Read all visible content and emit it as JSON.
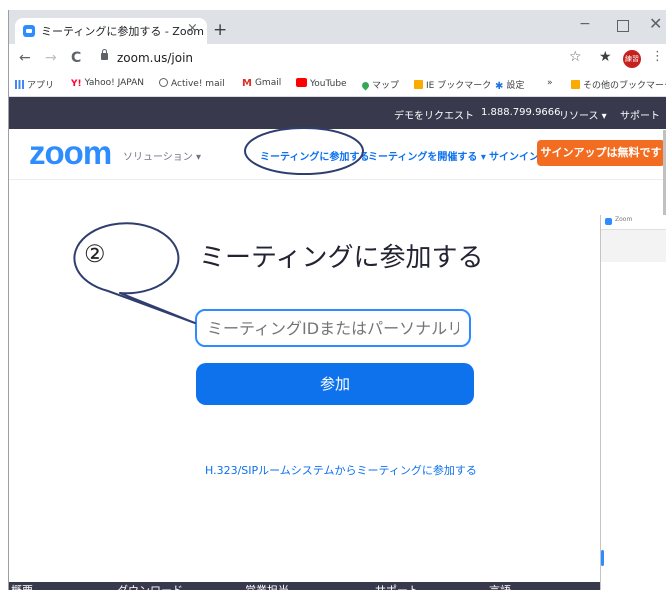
{
  "browser": {
    "tab_title": "ミーティングに参加する - Zoom",
    "tab_close": "×",
    "new_tab": "+",
    "window_minimize": "−",
    "window_close": "✕",
    "url": "zoom.us/join",
    "back": "←",
    "forward": "→",
    "reload": "C",
    "star": "☆",
    "extensions": "★",
    "avatar_text": "練習",
    "menu": "⋮"
  },
  "bookmarks": {
    "items": [
      {
        "label": "アプリ",
        "icon": "apps-grid-icon",
        "color": "#4285f4"
      },
      {
        "label": "Yahoo! JAPAN",
        "icon": "yahoo-icon",
        "color": "#ff0033"
      },
      {
        "label": "Active! mail",
        "icon": "globe-icon",
        "color": "#5f6368"
      },
      {
        "label": "Gmail",
        "icon": "gmail-icon",
        "color": "#d93025"
      },
      {
        "label": "YouTube",
        "icon": "youtube-icon",
        "color": "#ff0000"
      },
      {
        "label": "マップ",
        "icon": "maps-icon",
        "color": "#34a853"
      },
      {
        "label": "IE ブックマーク",
        "icon": "folder-icon",
        "color": "#f9ab00"
      },
      {
        "label": "設定",
        "icon": "gear-icon",
        "color": "#1a73e8"
      },
      {
        "label": "»",
        "icon": "more-icon",
        "color": "#5f6368"
      },
      {
        "label": "その他のブックマーク",
        "icon": "folder-icon",
        "color": "#f9ab00"
      }
    ]
  },
  "site": {
    "topbar": {
      "demo": "デモをリクエスト",
      "phone": "1.888.799.9666",
      "resources": "リソース ▾",
      "support": "サポート"
    },
    "nav": {
      "logo": "zoom",
      "solutions": "ソリューション ▾",
      "join": "ミーティングに参加する",
      "host": "ミーティングを開催する ▾",
      "signin": "サインイン",
      "signup": "サインアップは無料です"
    },
    "join": {
      "heading": "ミーティングに参加する",
      "input_placeholder": "ミーティングIDまたはパーソナルリンク名",
      "button": "参加",
      "sip_link": "H.323/SIPルームシステムからミーティングに参加する"
    },
    "footer": [
      "概要",
      "ダウンロード",
      "営業担当",
      "サポート",
      "言語"
    ]
  },
  "side_window": {
    "title": "Zoom"
  },
  "annotation": {
    "marker": "②"
  },
  "colors": {
    "zoom_blue": "#2d8cff",
    "join_button": "#0e72ed",
    "signup_orange": "#f26d21",
    "topbar_dark": "#39394d",
    "annotation_navy": "#2f3e6e"
  }
}
